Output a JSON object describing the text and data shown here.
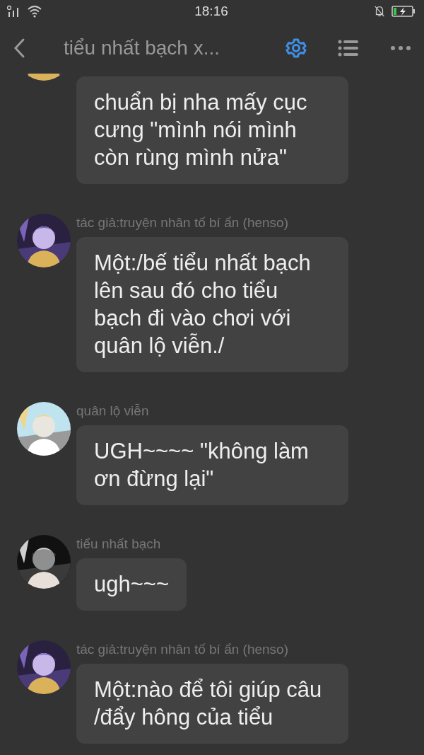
{
  "status_bar": {
    "time": "18:16"
  },
  "header": {
    "title": "tiểu nhất bạch x..."
  },
  "messages": [
    {
      "text": "chuẩn bị nha mấy cục cưng \"mình nói mình còn rùng mình nửa\""
    },
    {
      "sender": "tác giả:truyện nhân tố bí ẩn (henso)",
      "text": "Một:/bế tiểu nhất bạch lên sau đó cho tiểu bạch đi vào chơi với quân lộ viễn./"
    },
    {
      "sender": "quân lộ viễn",
      "text": "UGH~~~~ \"không làm ơn đừng lại\""
    },
    {
      "sender": "tiểu nhất bạch",
      "text": "ugh~~~"
    },
    {
      "sender": "tác giả:truyện nhân tố bí ẩn (henso)",
      "text": "Một:nào để tôi giúp câu /đẩy hông của tiểu"
    }
  ]
}
